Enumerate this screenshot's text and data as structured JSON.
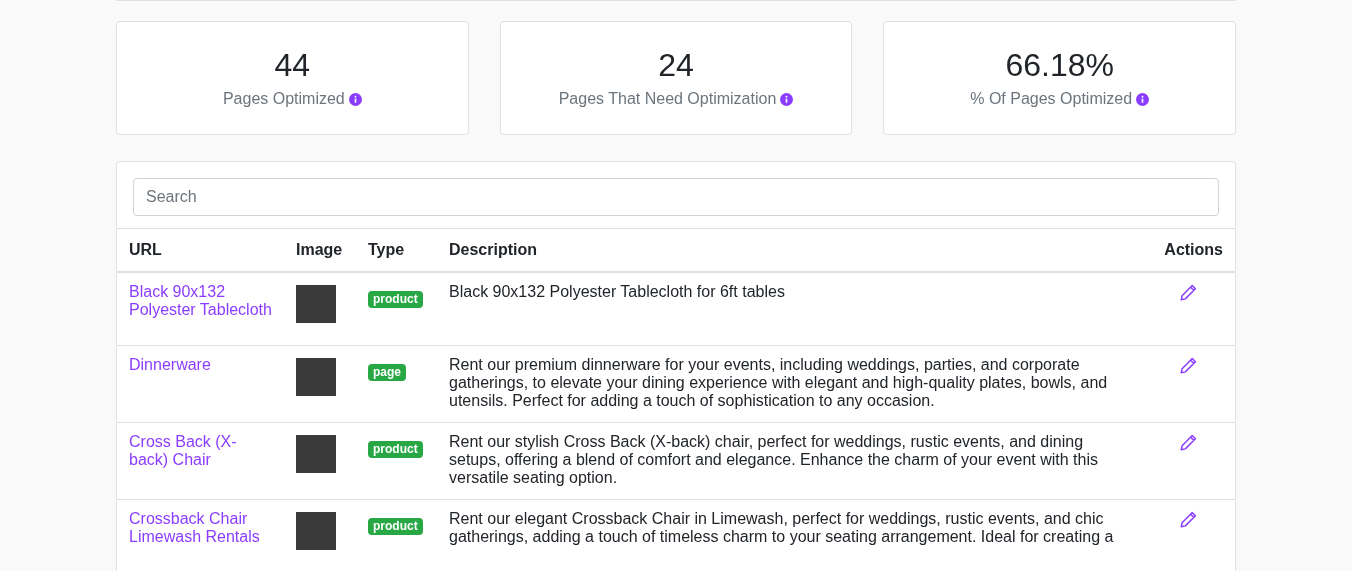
{
  "stats": [
    {
      "value": "44",
      "label": "Pages Optimized"
    },
    {
      "value": "24",
      "label": "Pages That Need Optimization"
    },
    {
      "value": "66.18%",
      "label": "% Of Pages Optimized"
    }
  ],
  "search": {
    "placeholder": "Search"
  },
  "table": {
    "columns": [
      "URL",
      "Image",
      "Type",
      "Description",
      "Actions"
    ],
    "rows": [
      {
        "url": "Black 90x132 Polyester Tablecloth",
        "type": "product",
        "description": "Black 90x132 Polyester Tablecloth for 6ft tables"
      },
      {
        "url": "Dinnerware",
        "type": "page",
        "description": "Rent our premium dinnerware for your events, including weddings, parties, and corporate gatherings, to elevate your dining experience with elegant and high-quality plates, bowls, and utensils. Perfect for adding a touch of sophistication to any occasion."
      },
      {
        "url": "Cross Back (X-back) Chair",
        "type": "product",
        "description": "Rent our stylish Cross Back (X-back) chair, perfect for weddings, rustic events, and dining setups, offering a blend of comfort and elegance. Enhance the charm of your event with this versatile seating option."
      },
      {
        "url": "Crossback Chair Limewash Rentals",
        "type": "product",
        "description": "Rent our elegant Crossback Chair in Limewash, perfect for weddings, rustic events, and chic gatherings, adding a touch of timeless charm to your seating arrangement. Ideal for creating a"
      }
    ]
  }
}
